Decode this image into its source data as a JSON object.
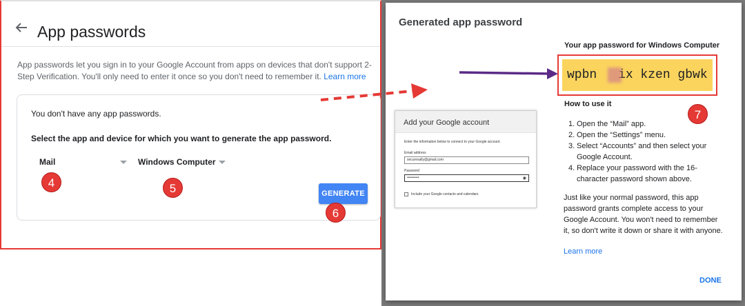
{
  "left_panel": {
    "title": "App passwords",
    "description": "App passwords let you sign in to your Google Account from apps on devices that don't support 2-Step Verification. You'll only need to enter it once so you don't need to remember it.",
    "learn_more": "Learn more",
    "card": {
      "no_passwords": "You don't have any app passwords.",
      "select_prompt": "Select the app and device for which you want to generate the app password.",
      "app_dropdown": "Mail",
      "device_dropdown": "Windows Computer",
      "generate_label": "GENERATE"
    }
  },
  "badges": {
    "b4": "4",
    "b5": "5",
    "b6": "6",
    "b7": "7"
  },
  "dialog": {
    "title": "Generated app password",
    "password_label": "Your app password for Windows Computer",
    "password_start": "wpbn ",
    "password_end": "ix kzen gbwk",
    "how_to_title": "How to use it",
    "steps": [
      "Open the “Mail” app.",
      "Open the “Settings” menu.",
      "Select “Accounts” and then select your Google Account.",
      "Replace your password with the 16-character password shown above."
    ],
    "note": "Just like your normal password, this app password grants complete access to your Google Account. You won't need to remember it, so don't write it down or share it with anyone.",
    "learn_more": "Learn more",
    "done_label": "DONE"
  },
  "google_window": {
    "title": "Add your Google account",
    "info": "Enter the information below to connect to your Google account.",
    "email_label": "Email address",
    "email_value": "securesally@gmail.com",
    "password_label": "Password",
    "password_value": "••••••••••",
    "checkbox_label": "Include your Google contacts and calendars"
  },
  "colors": {
    "accent_blue": "#4285f4",
    "link_blue": "#1a73e8",
    "highlight_red": "#e53935",
    "password_yellow": "#fbd45e",
    "arrow_purple": "#5b2a86"
  },
  "icons": {
    "back": "arrow-left-icon",
    "eye": "eye-icon",
    "dropdown": "caret-down-icon"
  }
}
